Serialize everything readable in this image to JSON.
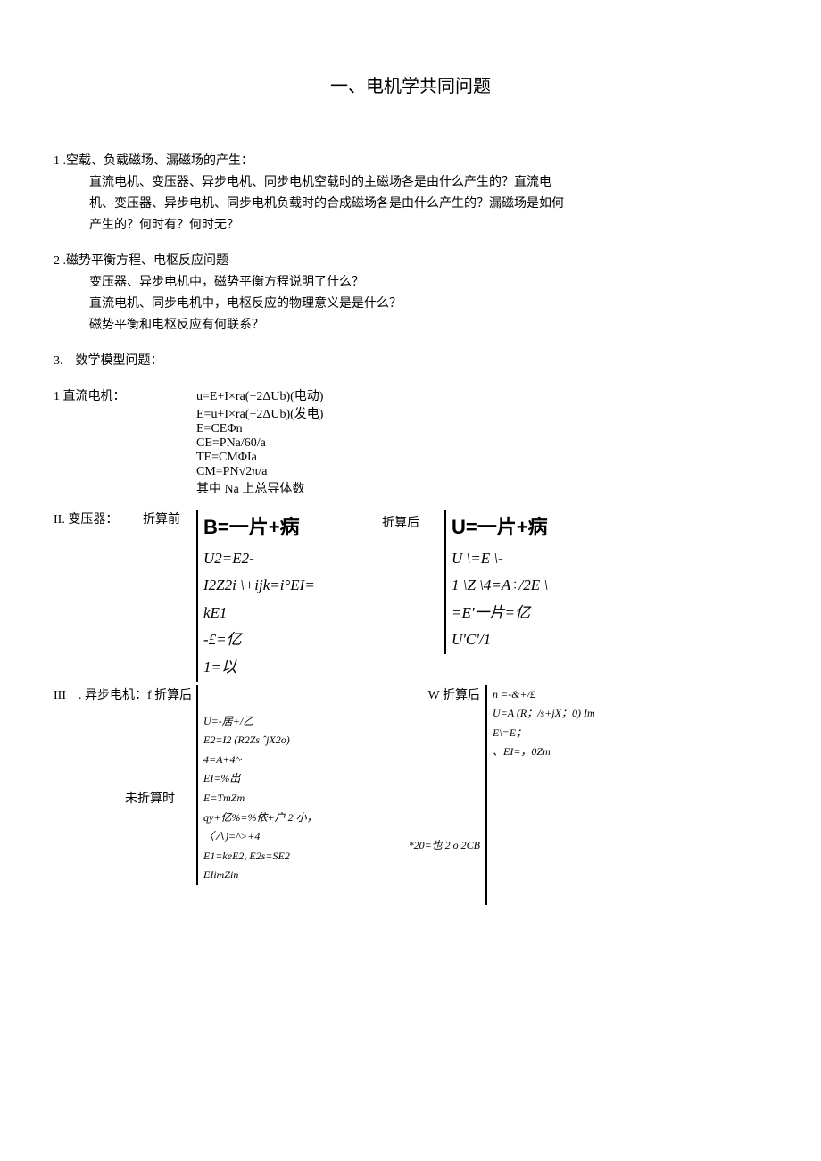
{
  "title": "一、电机学共同问题",
  "s1": {
    "head": "1 .空载、负载磁场、漏磁场的产生：",
    "l1": "直流电机、变压器、异步电机、同步电机空载时的主磁场各是由什么产生的？直流电",
    "l2": "机、变压器、异步电机、同步电机负载时的合成磁场各是由什么产生的？漏磁场是如何",
    "l3": "产生的？何时有？何时无？"
  },
  "s2": {
    "head": "2 .磁势平衡方程、电枢反应问题",
    "l1": "变压器、异步电机中，磁势平衡方程说明了什么？",
    "l2": "直流电机、同步电机中，电枢反应的物理意义是是什么？",
    "l3": "磁势平衡和电枢反应有何联系？"
  },
  "s3": {
    "head": "3.　数学模型问题："
  },
  "dc": {
    "label": "1 直流电机：",
    "f1": "u=E+I×ra(+2ΔUb)(电动)",
    "f2": "E=u+I×ra(+2ΔUb)(发电)",
    "f3": "E=CEΦn",
    "f4": "CE=PNa/60/a",
    "f5": "TE=CMΦIa",
    "f6": "CM=PN√2π/a",
    "f7": "其中 Na 上总导体数"
  },
  "tr": {
    "label": "II. 变压器：",
    "pre": "折算前",
    "post": "折算后",
    "left": {
      "e1": "B=一片+病",
      "e2": "U2=E2-",
      "e3": "I2Z2i \\+ijk=i°EI=",
      "e4": "kE1",
      "e5": "-£=亿",
      "e6": "1=以"
    },
    "right": {
      "e1": "U=一片+病",
      "e2": "U \\=E \\-",
      "e3": "1 \\Z \\4=A÷/2E \\",
      "e4": "=E'一片=亿",
      "e5": "U'C'/1"
    }
  },
  "as": {
    "label": "III　. 异步电机：f 折算后",
    "wlabel": "W 折算后",
    "r1": "n =-&+/£",
    "r2": "U=A (R；/s+jX；0) Im",
    "r3": "E\\=E；",
    "r4": "、EI=，0Zm",
    "l1": "U=-居+/乙",
    "l2": "E2=I2 (R2Zs ˆjX2o)",
    "l3": "4=A+4^·",
    "l4": "EI=%出",
    "unlabel": "未折算时",
    "l5": "E=TmZm",
    "l6": "qy+亿%=%依+户 2 小，",
    "starnote": "*20=也 2 o 2CB",
    "l7": "〈∧)=^>+4",
    "l8": "E1=keE2, E2s=SE2",
    "l9": "EIimZin"
  }
}
